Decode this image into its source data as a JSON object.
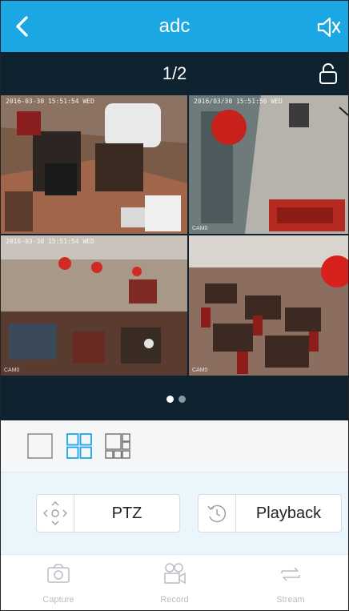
{
  "header": {
    "title": "adc",
    "back_icon": "chevron-left-icon",
    "mute_icon": "speaker-mute-icon"
  },
  "pager": {
    "page_indicator": "1/2",
    "lock_icon": "lock-icon"
  },
  "cameras": [
    {
      "timestamp": "2016-03-30 15:51:54 WED",
      "tag": ""
    },
    {
      "timestamp": "2016/03/30 15:51:56 WED",
      "tag": "CAM0"
    },
    {
      "timestamp": "2016-03-30 15:51:54 WED",
      "tag": "CAM0"
    },
    {
      "timestamp": "",
      "tag": "CAM0"
    }
  ],
  "page_dots": {
    "count": 2,
    "active": 0
  },
  "layouts": [
    {
      "name": "single",
      "selected": false
    },
    {
      "name": "quad",
      "selected": true
    },
    {
      "name": "multi",
      "selected": false
    }
  ],
  "controls": {
    "ptz_label": "PTZ",
    "playback_label": "Playback"
  },
  "tabs": {
    "capture_label": "Capture",
    "record_label": "Record",
    "stream_label": "Stream"
  },
  "colors": {
    "header": "#1aa7e3",
    "dark_bar": "#0e2230",
    "accent": "#1aa7e3"
  }
}
